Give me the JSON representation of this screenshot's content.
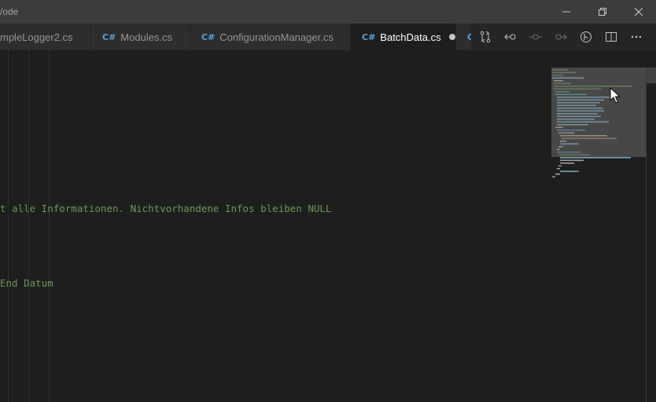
{
  "window": {
    "title": "/ode"
  },
  "tabs": [
    {
      "label": "mpleLogger2.cs",
      "icon": "",
      "active": false,
      "dirty": false
    },
    {
      "label": "Modules.cs",
      "icon": "C#",
      "active": false,
      "dirty": false
    },
    {
      "label": "ConfigurationManager.cs",
      "icon": "C#",
      "active": false,
      "dirty": false
    },
    {
      "label": "BatchData.cs",
      "icon": "C#",
      "active": true,
      "dirty": true
    },
    {
      "label": "",
      "icon": "C#",
      "active": false,
      "dirty": false
    }
  ],
  "toolbar": {
    "icons": [
      "source-control-compare-icon",
      "go-back-icon",
      "commit-icon",
      "go-forward-icon",
      "git-history-icon",
      "split-editor-icon",
      "more-actions-icon"
    ]
  },
  "editor": {
    "lines": [
      {
        "text": "t alle Informationen. Nichtvorhandene Infos bleiben NULL"
      },
      {
        "text": "End Datum"
      }
    ]
  },
  "colors": {
    "comment": "#6a9955",
    "editor_bg": "#1e1e1e",
    "titlebar_bg": "#3c3c3c",
    "tab_bg": "#2d2d2d"
  }
}
